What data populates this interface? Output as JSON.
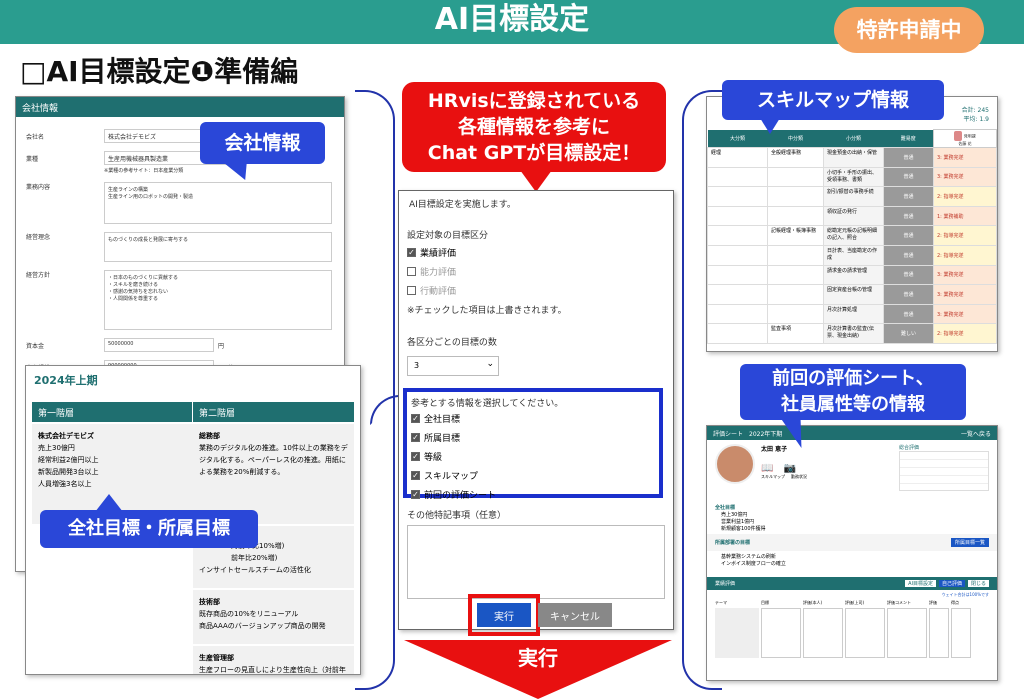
{
  "header": {
    "title": "AI目標設定",
    "badge": "特許申請中"
  },
  "subtitle": "□AI目標設定❶準備編",
  "callouts": {
    "company": "会社情報",
    "goals": "全社目標・所属目標",
    "hrvis_line1": "HRvisに登録されている",
    "hrvis_line2": "各種情報を参考に",
    "hrvis_line3": "Chat GPTが目標設定！",
    "skillmap": "スキルマップ情報",
    "eval_line1": "前回の評価シート、",
    "eval_line2": "社員属性等の情報",
    "exec_arrow": "実行"
  },
  "company": {
    "panel_title": "会社情報",
    "fields": [
      {
        "label": "会社名",
        "value": "株式会社デモビズ"
      },
      {
        "label": "業種",
        "value": "生産用機械器具製造業",
        "note": "※業種の参考サイト：日本産業分類"
      },
      {
        "label": "業務内容",
        "value": "生産ラインの構築\n生産ライン用のロボットの開発・製造"
      },
      {
        "label": "経営理念",
        "value": "ものづくりの成長と発展に寄与する"
      },
      {
        "label": "経営方針",
        "value": "・日本のものづくりに貢献する\n・スキルを磨き続ける\n・感謝の気持ちを忘れない\n・人間関係を尊重する"
      },
      {
        "label": "資本金",
        "value": "50000000",
        "unit": "円"
      },
      {
        "label": "売上規模",
        "value": "900000000",
        "unit": "円／年"
      }
    ]
  },
  "goals": {
    "period": "2024年上期",
    "col1": "第一階層",
    "col2": "第二階層",
    "company_name": "株式会社デモビズ",
    "company_goals": [
      "売上30億円",
      "経常利益2億円以上",
      "新製品開発3台以上",
      "人員増強3名以上"
    ],
    "dept1": "総務部",
    "dept1_goals": "業務のデジタル化の推進。10件以上の業務をデジタル化する。ペーパーレス化の推進。用紙による業務を20%削減する。",
    "dept2_partial1": "対前年比10%増)",
    "dept2_partial2": "前年比20%増)",
    "dept2_goal3": "インサイトセールスチームの活性化",
    "dept3": "技術部",
    "dept3_goals": [
      "既存商品の10%をリニューアル",
      "商品AAAのバージョンアップ商品の開発"
    ],
    "dept4": "生産管理部",
    "dept4_goals": "生産フローの見直しにより生産性向上（対前年"
  },
  "ai_form": {
    "heading": "AI目標設定を実施します。",
    "target_label": "設定対象の目標区分",
    "targets": [
      {
        "label": "業績評価",
        "checked": true
      },
      {
        "label": "能力評価",
        "checked": false
      },
      {
        "label": "行動評価",
        "checked": false
      }
    ],
    "target_note": "※チェックした項目は上書きされます。",
    "count_label": "各区分ごとの目標の数",
    "count_value": "3",
    "ref_label": "参考とする情報を選択してください。",
    "refs": [
      "全社目標",
      "所属目標",
      "等級",
      "スキルマップ",
      "前回の評価シート"
    ],
    "other_label": "その他特記事項（任意）",
    "run_button": "実行",
    "cancel_button": "キャンセル"
  },
  "skillmap": {
    "total": "合計: 245",
    "average": "平均: 1.9",
    "columns": [
      "大分類",
      "中分類",
      "小分類",
      "難易度"
    ],
    "user_name": "佐藤 花",
    "user_sub": "発明課",
    "rows": [
      {
        "major": "経理",
        "middle": "全般経理事務",
        "minor": "現金預金の出納・保管",
        "level": "普通",
        "score": "3: 業務完遂",
        "color": "#fde7d6"
      },
      {
        "major": "",
        "middle": "",
        "minor": "小切手・手形の振出、受領事務、書類",
        "level": "普通",
        "score": "3: 業務完遂",
        "color": "#fde7d6"
      },
      {
        "major": "",
        "middle": "",
        "minor": "割引/振替の事務手続",
        "level": "普通",
        "score": "2: 指導完遂",
        "color": "#fff6d1"
      },
      {
        "major": "",
        "middle": "",
        "minor": "領収証の発行",
        "level": "普通",
        "score": "1: 業務補助",
        "color": "#fde7d6"
      },
      {
        "major": "",
        "middle": "記帳経理・帳簿事務",
        "minor": "総勘定元帳の記帳明細の記入、照合",
        "level": "普通",
        "score": "2: 指導完遂",
        "color": "#fff6d1"
      },
      {
        "major": "",
        "middle": "",
        "minor": "日計表、当座勘定の作成",
        "level": "普通",
        "score": "2: 指導完遂",
        "color": "#fff6d1"
      },
      {
        "major": "",
        "middle": "",
        "minor": "請求金の請求管理",
        "level": "普通",
        "score": "3: 業務完遂",
        "color": "#fde7d6"
      },
      {
        "major": "",
        "middle": "",
        "minor": "固定資産台帳の管理",
        "level": "普通",
        "score": "3: 業務完遂",
        "color": "#fde7d6"
      },
      {
        "major": "",
        "middle": "",
        "minor": "月次計算処理",
        "level": "普通",
        "score": "3: 業務完遂",
        "color": "#fde7d6"
      },
      {
        "major": "",
        "middle": "監査事項",
        "minor": "月次計算書の監査(伝票、現金出納)",
        "level": "難しい",
        "score": "2: 指導完遂",
        "color": "#fff6d1"
      }
    ]
  },
  "eval": {
    "title": "評価シート",
    "period": "2022年下期",
    "back": "一覧へ戻る",
    "employee": "太田 恵子",
    "icons": [
      "スキルマップ",
      "勤務状況"
    ],
    "summary_title": "総合評価",
    "company_goals_label": "全社目標",
    "company_goal_items": [
      "売上30億円",
      "営業利益1億円",
      "新規顧客100件獲得"
    ],
    "dept_goals_label": "所属部署の目標",
    "dept_goal_items": [
      "基幹業務システムの刷新",
      "インボイス制度フローの確立"
    ],
    "dept_button": "所属目標一覧",
    "perf_label": "業績評価",
    "perf_tab1": "AI目標設定",
    "perf_tab2": "自己評価",
    "perf_close": "閉じる",
    "wait_text": "ウェイト合計は100%です",
    "table_cols": [
      "テーマ",
      "目標",
      "評価(本人)",
      "評価(上司)",
      "評価コメント",
      "評価",
      "得点"
    ]
  }
}
